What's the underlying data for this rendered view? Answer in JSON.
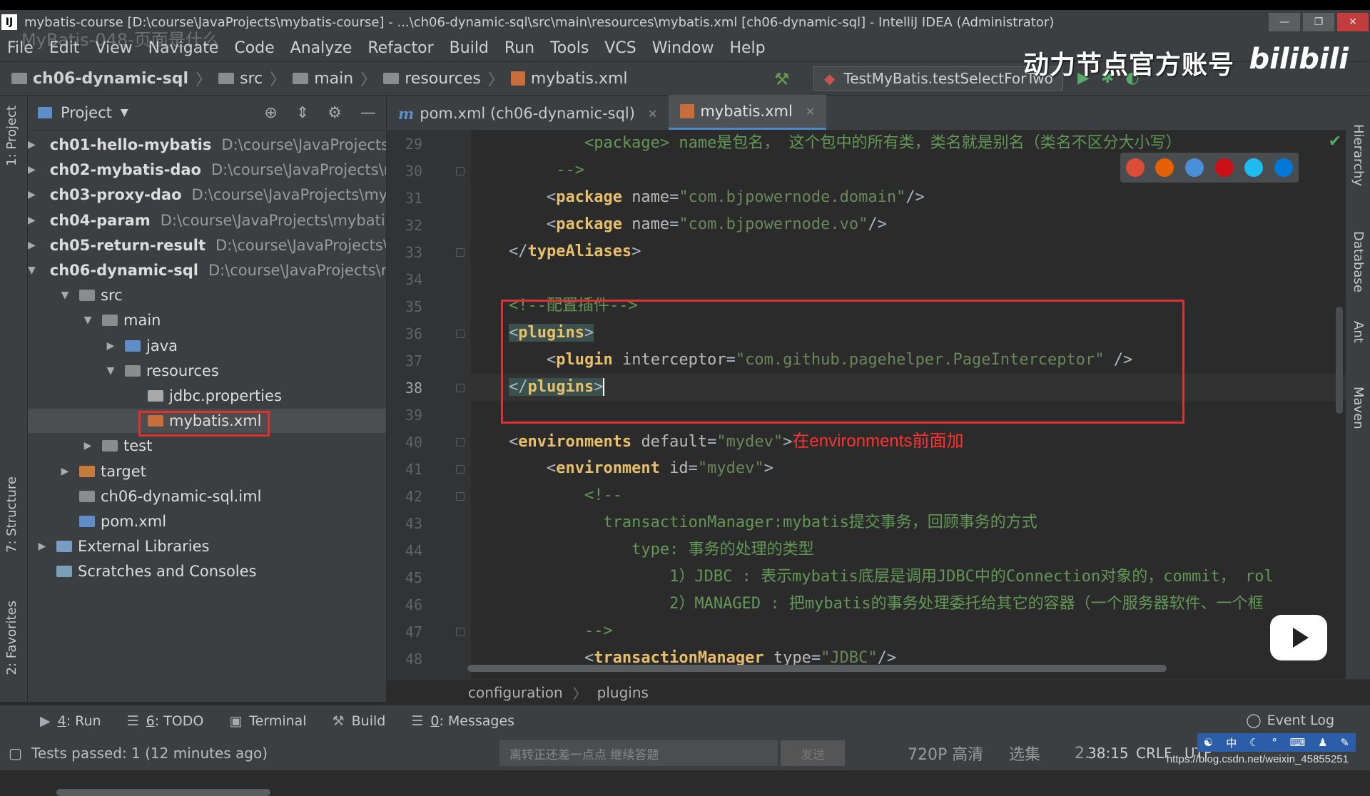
{
  "window": {
    "title": "mybatis-course [D:\\course\\JavaProjects\\mybatis-course] - ...\\ch06-dynamic-sql\\src\\main\\resources\\mybatis.xml [ch06-dynamic-sql] - IntelliJ IDEA (Administrator)",
    "overlay_title": "MyBatis-048-页面是什么"
  },
  "menu": [
    "File",
    "Edit",
    "View",
    "Navigate",
    "Code",
    "Analyze",
    "Refactor",
    "Build",
    "Run",
    "Tools",
    "VCS",
    "Window",
    "Help"
  ],
  "nav": {
    "crumbs": [
      "ch06-dynamic-sql",
      "src",
      "main",
      "resources",
      "mybatis.xml"
    ],
    "run_config": "TestMyBatis.testSelectForTwo"
  },
  "watermark": {
    "channel": "动力节点官方账号",
    "logo": "bilibili"
  },
  "left_tabs": {
    "project": "1: Project",
    "structure": "7: Structure",
    "favorites": "2: Favorites"
  },
  "right_tabs": {
    "hierarchy": "Hierarchy",
    "database": "Database",
    "ant": "Ant",
    "maven": "Maven"
  },
  "project_panel": {
    "title": "Project",
    "tree": [
      {
        "arrow": "▶",
        "name": "ch01-hello-mybatis",
        "path": "D:\\course\\JavaProjects\\r",
        "bold": true,
        "icon": "module-folder"
      },
      {
        "arrow": "▶",
        "name": "ch02-mybatis-dao",
        "path": "D:\\course\\JavaProjects\\m",
        "bold": true,
        "icon": "module-folder"
      },
      {
        "arrow": "▶",
        "name": "ch03-proxy-dao",
        "path": "D:\\course\\JavaProjects\\myb",
        "bold": true,
        "icon": "module-folder"
      },
      {
        "arrow": "▶",
        "name": "ch04-param",
        "path": "D:\\course\\JavaProjects\\mybatis-",
        "bold": true,
        "icon": "module-folder"
      },
      {
        "arrow": "▶",
        "name": "ch05-return-result",
        "path": "D:\\course\\JavaProjects\\m",
        "bold": true,
        "icon": "module-folder"
      },
      {
        "arrow": "▼",
        "name": "ch06-dynamic-sql",
        "path": "D:\\course\\JavaProjects\\my",
        "bold": true,
        "icon": "module-folder"
      },
      {
        "arrow": "▼",
        "name": "src",
        "path": "",
        "bold": false,
        "icon": "folder"
      },
      {
        "arrow": "▼",
        "name": "main",
        "path": "",
        "bold": false,
        "icon": "folder"
      },
      {
        "arrow": "▶",
        "name": "java",
        "path": "",
        "bold": false,
        "icon": "blue-folder"
      },
      {
        "arrow": "▼",
        "name": "resources",
        "path": "",
        "bold": false,
        "icon": "resources-folder"
      },
      {
        "arrow": "",
        "name": "jdbc.properties",
        "path": "",
        "bold": false,
        "icon": "properties-file"
      },
      {
        "arrow": "",
        "name": "mybatis.xml",
        "path": "",
        "bold": false,
        "icon": "xml-file"
      },
      {
        "arrow": "▶",
        "name": "test",
        "path": "",
        "bold": false,
        "icon": "folder"
      },
      {
        "arrow": "▶",
        "name": "target",
        "path": "",
        "bold": false,
        "icon": "orange-folder"
      },
      {
        "arrow": "",
        "name": "ch06-dynamic-sql.iml",
        "path": "",
        "bold": false,
        "icon": "iml-file"
      },
      {
        "arrow": "",
        "name": "pom.xml",
        "path": "",
        "bold": false,
        "icon": "maven-file"
      },
      {
        "arrow": "▶",
        "name": "External Libraries",
        "path": "",
        "bold": false,
        "icon": "libraries"
      },
      {
        "arrow": "",
        "name": "Scratches and Consoles",
        "path": "",
        "bold": false,
        "icon": "scratches"
      }
    ]
  },
  "tabs": [
    {
      "label": "pom.xml (ch06-dynamic-sql)",
      "active": false
    },
    {
      "label": "mybatis.xml",
      "active": true
    }
  ],
  "code": {
    "line_numbers": [
      "29",
      "30",
      "31",
      "32",
      "33",
      "34",
      "35",
      "36",
      "37",
      "38",
      "39",
      "40",
      "41",
      "42",
      "43",
      "44",
      "45",
      "46",
      "47",
      "48"
    ],
    "l29_comment": "<package> name是包名， 这个包中的所有类，类名就是别名（类名不区分大小写）",
    "l30_comment": "-->",
    "pkg1_value": "\"com.bjpowernode.domain\"",
    "pkg2_value": "\"com.bjpowernode.vo\"",
    "type_aliases_close": "typeAliases",
    "l35_comment": "<!--配置插件-->",
    "plugins_tag": "plugins",
    "plugin_tag": "plugin",
    "interceptor_attr": "interceptor",
    "interceptor_value": "\"com.github.pagehelper.PageInterceptor\"",
    "environments_tag": "environments",
    "default_attr": "default",
    "default_value": "\"mydev\"",
    "annotation": "在environments前面加",
    "environment_tag": "environment",
    "id_attr": "id",
    "id_value": "\"mydev\"",
    "l42_comment": "<!--",
    "l43_comment": "transactionManager:mybatis提交事务，回顾事务的方式",
    "l44_comment": "type: 事务的处理的类型",
    "l45_comment": "1）JDBC : 表示mybatis底层是调用JDBC中的Connection对象的，commit， rol",
    "l46_comment": "2）MANAGED : 把mybatis的事务处理委托给其它的容器（一个服务器软件、一个框",
    "l47_comment": "-->",
    "tm_tag": "transactionManager",
    "type_attr": "type",
    "type_value": "\"JDBC\""
  },
  "breadcrumb": [
    "configuration",
    "plugins"
  ],
  "tool_windows": [
    {
      "key": "4",
      "label": ": Run",
      "icon": "run-icon"
    },
    {
      "key": "6",
      "label": ": TODO",
      "icon": "todo-icon"
    },
    {
      "key": "",
      "label": "Terminal",
      "icon": "terminal-icon"
    },
    {
      "key": "",
      "label": "Build",
      "icon": "build-icon"
    },
    {
      "key": "0",
      "label": ": Messages",
      "icon": "messages-icon"
    }
  ],
  "event_log": "Event Log",
  "status": {
    "tests": "Tests passed: 1 (12 minutes ago)",
    "video_input_placeholder": "离转正还差一点点 继续答题",
    "video_send": "发送",
    "quality": "720P 高清",
    "episodes": "选集",
    "position": "38:15",
    "speed": "2.",
    "line_sep": "CRLF",
    "encoding": "UTF"
  },
  "url_watermark": "https://blog.csdn.net/weixin_45855251"
}
